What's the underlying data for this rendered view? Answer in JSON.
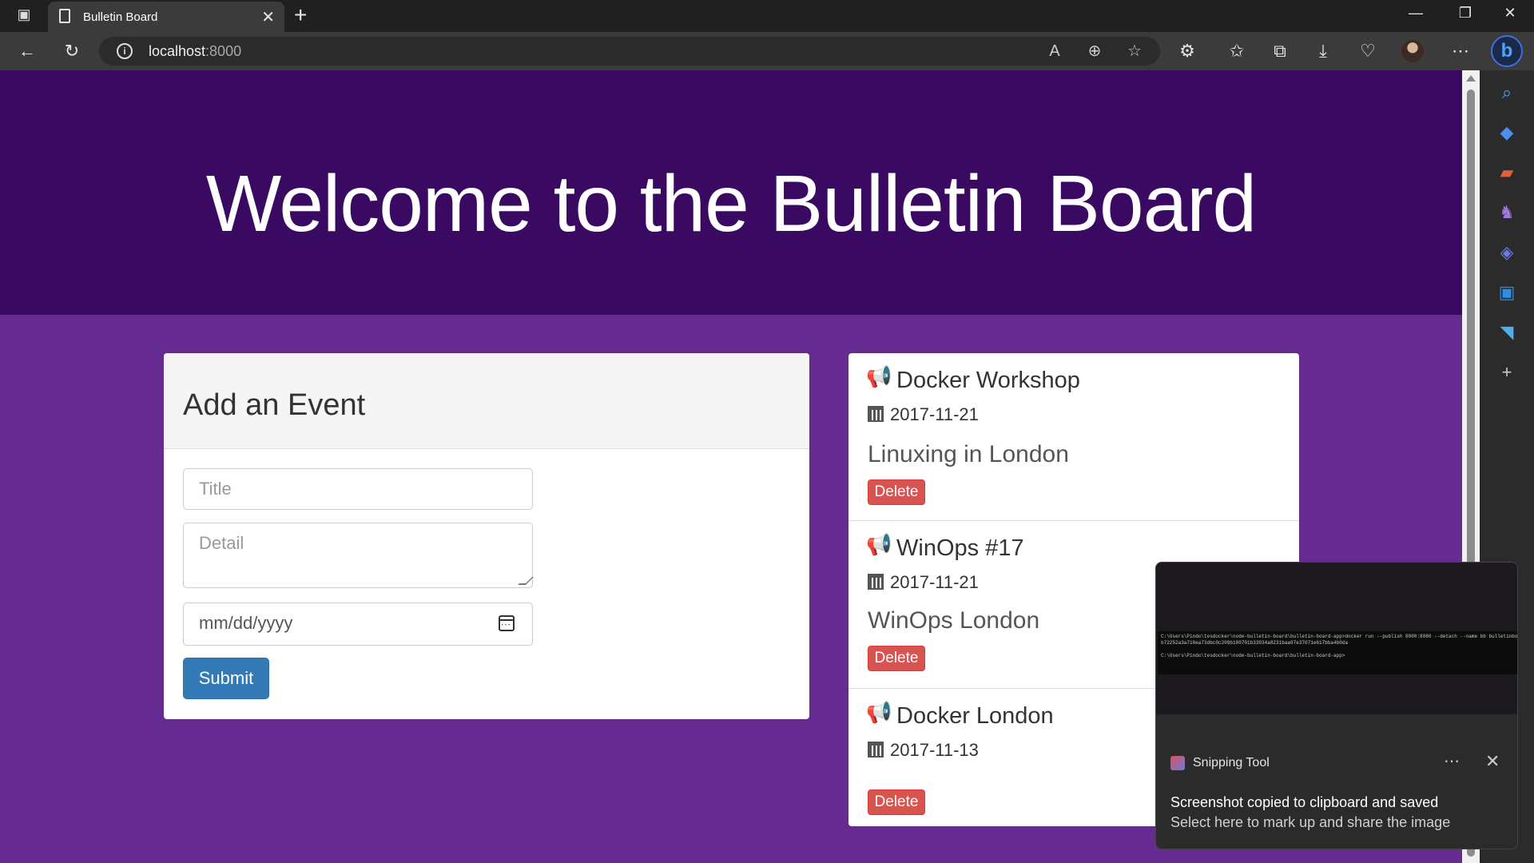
{
  "browser": {
    "tab_title": "Bulletin Board",
    "url_host": "localhost",
    "url_port": ":8000"
  },
  "page": {
    "hero_title": "Welcome to the Bulletin Board",
    "form": {
      "heading": "Add an Event",
      "title_placeholder": "Title",
      "detail_placeholder": "Detail",
      "date_placeholder": "mm/dd/yyyy",
      "submit_label": "Submit"
    },
    "events": [
      {
        "title": "Docker Workshop",
        "date": "2017-11-21",
        "detail": "Linuxing in London",
        "delete_label": "Delete"
      },
      {
        "title": "WinOps #17",
        "date": "2017-11-21",
        "detail": "WinOps London",
        "delete_label": "Delete"
      },
      {
        "title": "Docker London",
        "date": "2017-11-13",
        "detail": "",
        "delete_label": "Delete"
      }
    ]
  },
  "notification": {
    "app_name": "Snipping Tool",
    "heading": "Screenshot copied to clipboard and saved",
    "body": "Select here to mark up and share the image",
    "terminal_text": "C:\\Users\\Pindo\\tesdocker\\node-bulletin-board\\bulletin-board-app>docker run --publish 8000:8080 --detach --name bb bulletinboard:1.0\nb72252a3a710ea73dbc0c209b180701b33934a8231baa07e37071e617bba4b0da\n\nC:\\Users\\Pindo\\tesdocker\\node-bulletin-board\\bulletin-board-app>"
  },
  "colors": {
    "hero": "#3a0a63",
    "page_bg": "#652b91",
    "primary_button": "#337ab7",
    "danger_button": "#d9534f"
  }
}
